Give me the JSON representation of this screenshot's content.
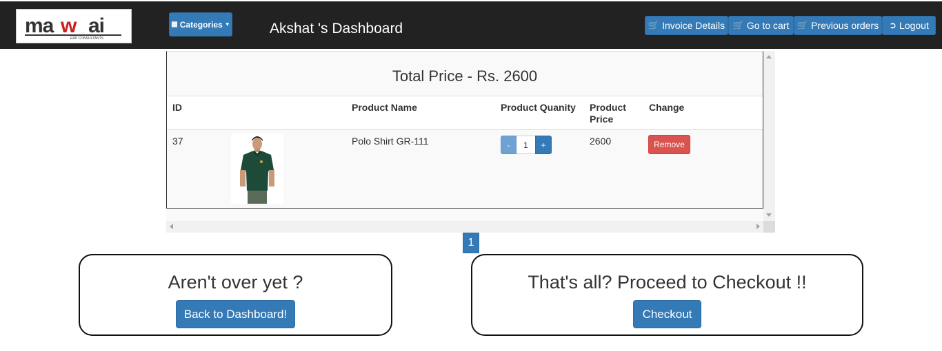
{
  "navbar": {
    "categories_label": "Categories",
    "dashboard_title": "Akshat 's Dashboard",
    "buttons": [
      {
        "label": "Invoice Details",
        "icon": "cart-icon"
      },
      {
        "label": "Go to cart",
        "icon": "cart-icon"
      },
      {
        "label": "Previous orders",
        "icon": "cart-icon"
      },
      {
        "label": "Logout",
        "icon": "logout-icon"
      }
    ]
  },
  "logo": {
    "text": "mawai",
    "tagline": "ERP CONSULTANTS"
  },
  "cart": {
    "total_label": "Total Price - Rs. 2600",
    "headers": {
      "id": "ID",
      "name": "Product Name",
      "quantity": "Product Quanity",
      "price_line1": "Product",
      "price_line2": "Price",
      "change": "Change"
    },
    "rows": [
      {
        "id": "37",
        "name": "Polo Shirt GR-111",
        "quantity": "1",
        "price": "2600",
        "minus_label": "-",
        "plus_label": "+",
        "remove_label": "Remove"
      }
    ]
  },
  "pagination": {
    "current_page": "1"
  },
  "continue_box": {
    "title": "Aren't over yet ?",
    "button_label": "Back to Dashboard!"
  },
  "checkout_box": {
    "title": "That's all? Proceed to Checkout !!",
    "button_label": "Checkout"
  },
  "colors": {
    "navbar": "#222222",
    "primary": "#337ab7",
    "danger": "#d9534f"
  }
}
